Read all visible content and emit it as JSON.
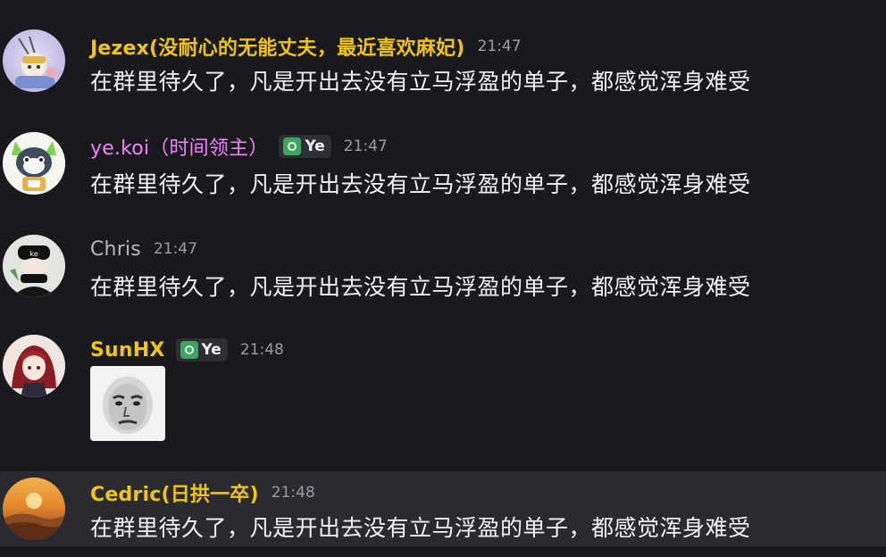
{
  "messages": [
    {
      "name": "Jezex(没耐心的无能丈夫，最近喜欢麻妃)",
      "name_color": "#f1c40f",
      "time": "21:47",
      "text": "在群里待久了，凡是开出去没有立马浮盈的单子，都感觉浑身难受"
    },
    {
      "name": "ye.koi（时间领主）",
      "name_color": "#f47fff",
      "badge": "Ye",
      "time": "21:47",
      "text": "在群里待久了，凡是开出去没有立马浮盈的单子，都感觉浑身难受"
    },
    {
      "name": "Chris",
      "name_color": "#b5bac1",
      "time": "21:47",
      "text": "在群里待久了，凡是开出去没有立马浮盈的单子，都感觉浑身难受"
    },
    {
      "name": "SunHX",
      "name_color": "#f1c40f",
      "badge": "Ye",
      "time": "21:48",
      "sticker": "meme-face-sticker"
    },
    {
      "name": "Cedric(日拱一卒)",
      "name_color": "#f1c40f",
      "time": "21:48",
      "text": "在群里待久了，凡是开出去没有立马浮盈的单子，都感觉浑身难受"
    }
  ]
}
